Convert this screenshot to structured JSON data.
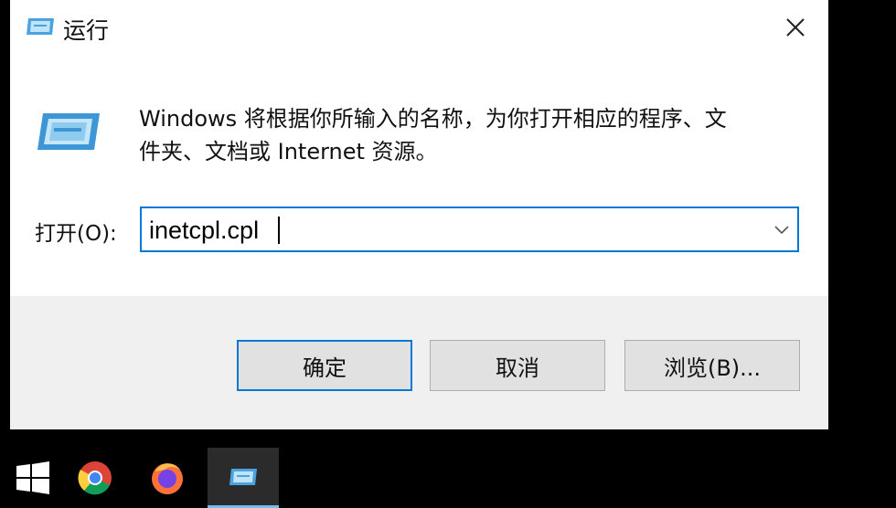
{
  "window": {
    "title": "运行",
    "close_label": "×"
  },
  "description": {
    "line1": "Windows 将根据你所输入的名称，为你打开相应的程序、文",
    "line2": "件夹、文档或 Internet 资源。"
  },
  "open_field": {
    "label": "打开(O):",
    "value": "inetcpl.cpl"
  },
  "buttons": {
    "ok": "确定",
    "cancel": "取消",
    "browse": "浏览(B)..."
  },
  "taskbar": {
    "items": [
      {
        "name": "start",
        "icon": "windows-logo-icon"
      },
      {
        "name": "chrome",
        "icon": "chrome-icon"
      },
      {
        "name": "firefox",
        "icon": "firefox-icon"
      },
      {
        "name": "run",
        "icon": "run-dialog-icon",
        "active": true
      }
    ]
  },
  "colors": {
    "accent": "#0078d7",
    "dialog_bg": "#ffffff",
    "footer_bg": "#f0f0f0",
    "button_bg": "#e1e1e1",
    "taskbar_bg": "#000000"
  }
}
